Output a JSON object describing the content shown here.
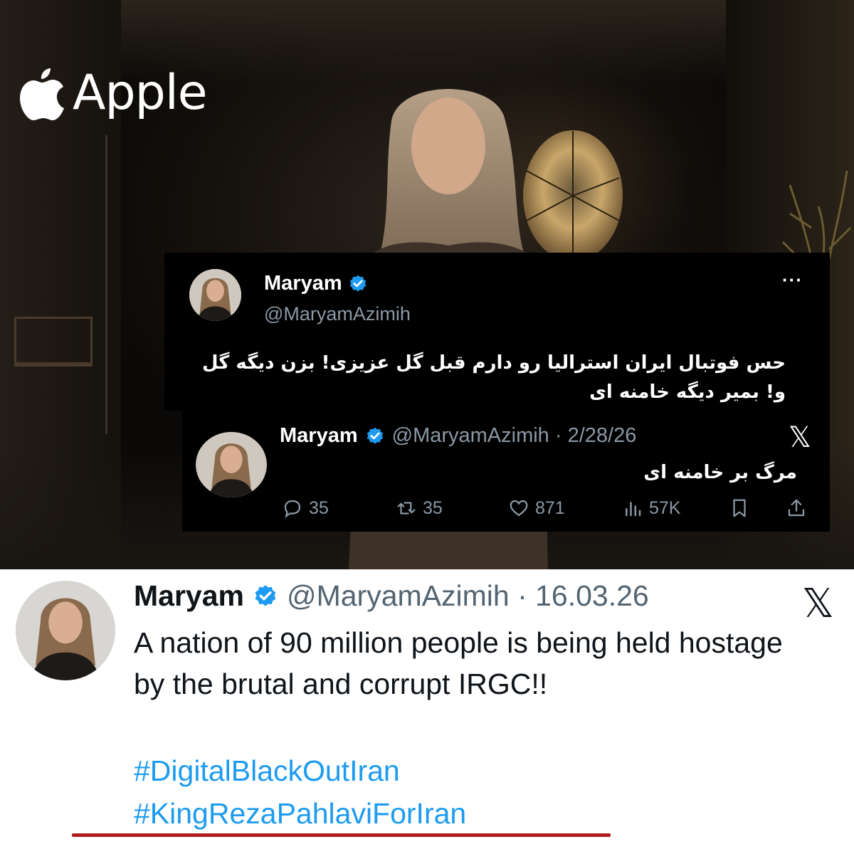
{
  "background": {
    "brand_label": "Apple"
  },
  "quoted_tweet": {
    "author_name": "Maryam",
    "author_handle": "@MaryamAzimih",
    "more_label": "···",
    "text": "حس فوتبال ایران استرالیا رو دارم قبل گل عزیزی! بزن دیگه گل و! بمیر دیگه خامنه ای"
  },
  "inner_tweet": {
    "author_name": "Maryam",
    "meta": "@MaryamAzimih · 2/28/26",
    "text": "مرگ بر خامنه ای",
    "counts": {
      "replies": "35",
      "reposts": "35",
      "likes": "871",
      "views": "57K"
    }
  },
  "main_tweet": {
    "author_name": "Maryam",
    "meta": "@MaryamAzimih · 16.03.26",
    "text": "A nation of 90 million people is being held hostage by the brutal and corrupt IRGC!!",
    "hashtags": [
      "#DigitalBlackOutIran",
      "#KingRezaPahlaviForIran"
    ]
  },
  "colors": {
    "verified": "#1d9bf0",
    "hashtag": "#1d9bf0",
    "underline": "#b01c1c",
    "dark_bg": "#000000"
  },
  "icons": [
    "apple-logo-icon",
    "verified-badge-icon",
    "more-options-icon",
    "x-logo-icon",
    "reply-icon",
    "repost-icon",
    "like-icon",
    "views-icon",
    "bookmark-icon",
    "share-icon"
  ]
}
